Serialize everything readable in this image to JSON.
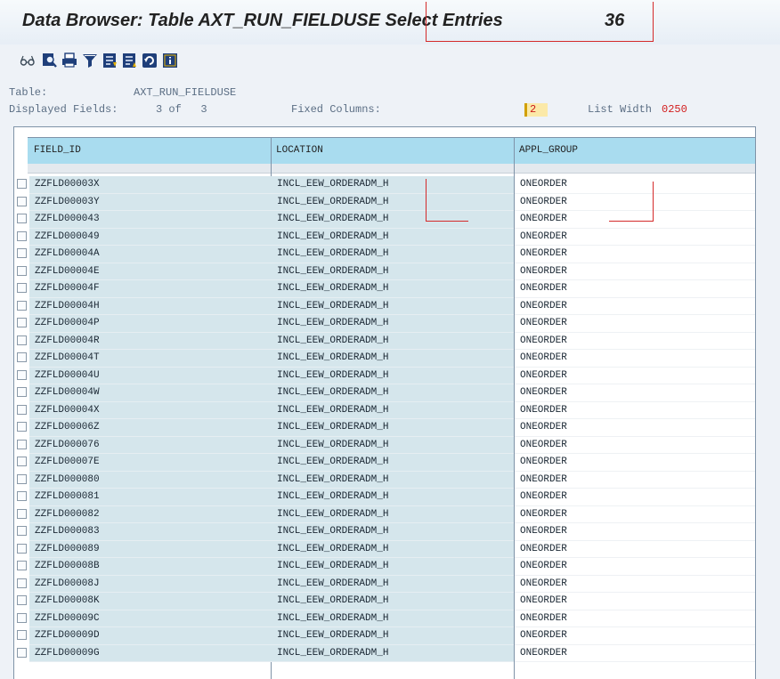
{
  "titlebar": {
    "title": "Data Browser: Table AXT_RUN_FIELDUSE Select Entries",
    "entry_count": "36"
  },
  "toolbar": {
    "icons": [
      "glasses-icon",
      "details-icon",
      "print-icon",
      "filter-icon",
      "sort-ascending-icon",
      "sort-descending-icon",
      "refresh-icon",
      "info-icon"
    ]
  },
  "info": {
    "table_label": "Table:",
    "table_name": "AXT_RUN_FIELDUSE",
    "displayed_fields_label": "Displayed Fields:",
    "displayed_fields_value": "3 of   3",
    "fixed_columns_label": "Fixed Columns:",
    "fixed_columns_value": "2",
    "list_width_label": "List Width",
    "list_width_value": "0250"
  },
  "grid": {
    "columns": [
      "FIELD_ID",
      "LOCATION",
      "APPL_GROUP"
    ],
    "rows": [
      [
        "ZZFLD00003X",
        "INCL_EEW_ORDERADM_H",
        "ONEORDER"
      ],
      [
        "ZZFLD00003Y",
        "INCL_EEW_ORDERADM_H",
        "ONEORDER"
      ],
      [
        "ZZFLD000043",
        "INCL_EEW_ORDERADM_H",
        "ONEORDER"
      ],
      [
        "ZZFLD000049",
        "INCL_EEW_ORDERADM_H",
        "ONEORDER"
      ],
      [
        "ZZFLD00004A",
        "INCL_EEW_ORDERADM_H",
        "ONEORDER"
      ],
      [
        "ZZFLD00004E",
        "INCL_EEW_ORDERADM_H",
        "ONEORDER"
      ],
      [
        "ZZFLD00004F",
        "INCL_EEW_ORDERADM_H",
        "ONEORDER"
      ],
      [
        "ZZFLD00004H",
        "INCL_EEW_ORDERADM_H",
        "ONEORDER"
      ],
      [
        "ZZFLD00004P",
        "INCL_EEW_ORDERADM_H",
        "ONEORDER"
      ],
      [
        "ZZFLD00004R",
        "INCL_EEW_ORDERADM_H",
        "ONEORDER"
      ],
      [
        "ZZFLD00004T",
        "INCL_EEW_ORDERADM_H",
        "ONEORDER"
      ],
      [
        "ZZFLD00004U",
        "INCL_EEW_ORDERADM_H",
        "ONEORDER"
      ],
      [
        "ZZFLD00004W",
        "INCL_EEW_ORDERADM_H",
        "ONEORDER"
      ],
      [
        "ZZFLD00004X",
        "INCL_EEW_ORDERADM_H",
        "ONEORDER"
      ],
      [
        "ZZFLD00006Z",
        "INCL_EEW_ORDERADM_H",
        "ONEORDER"
      ],
      [
        "ZZFLD000076",
        "INCL_EEW_ORDERADM_H",
        "ONEORDER"
      ],
      [
        "ZZFLD00007E",
        "INCL_EEW_ORDERADM_H",
        "ONEORDER"
      ],
      [
        "ZZFLD000080",
        "INCL_EEW_ORDERADM_H",
        "ONEORDER"
      ],
      [
        "ZZFLD000081",
        "INCL_EEW_ORDERADM_H",
        "ONEORDER"
      ],
      [
        "ZZFLD000082",
        "INCL_EEW_ORDERADM_H",
        "ONEORDER"
      ],
      [
        "ZZFLD000083",
        "INCL_EEW_ORDERADM_H",
        "ONEORDER"
      ],
      [
        "ZZFLD000089",
        "INCL_EEW_ORDERADM_H",
        "ONEORDER"
      ],
      [
        "ZZFLD00008B",
        "INCL_EEW_ORDERADM_H",
        "ONEORDER"
      ],
      [
        "ZZFLD00008J",
        "INCL_EEW_ORDERADM_H",
        "ONEORDER"
      ],
      [
        "ZZFLD00008K",
        "INCL_EEW_ORDERADM_H",
        "ONEORDER"
      ],
      [
        "ZZFLD00009C",
        "INCL_EEW_ORDERADM_H",
        "ONEORDER"
      ],
      [
        "ZZFLD00009D",
        "INCL_EEW_ORDERADM_H",
        "ONEORDER"
      ],
      [
        "ZZFLD00009G",
        "INCL_EEW_ORDERADM_H",
        "ONEORDER"
      ]
    ]
  },
  "colors": {
    "annotation": "#d42a2a",
    "header_bg": "#a9dcef",
    "key_cell_bg": "#d5e6ec"
  }
}
